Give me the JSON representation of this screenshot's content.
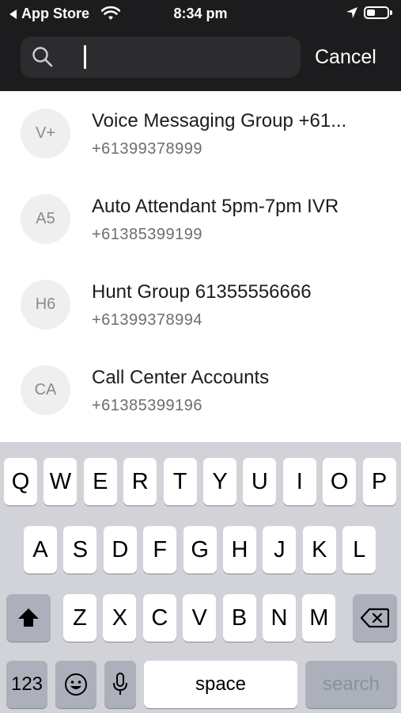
{
  "status_bar": {
    "back_label": "App Store",
    "time": "8:34 pm",
    "battery_level": 0.4
  },
  "search": {
    "value": "",
    "placeholder": "",
    "cancel_label": "Cancel"
  },
  "results": [
    {
      "initials": "V+",
      "name": "Voice Messaging Group +61...",
      "phone": "+61399378999"
    },
    {
      "initials": "A5",
      "name": "Auto Attendant 5pm-7pm IVR",
      "phone": "+61385399199"
    },
    {
      "initials": "H6",
      "name": "Hunt Group 61355556666",
      "phone": "+61399378994"
    },
    {
      "initials": "CA",
      "name": "Call Center Accounts",
      "phone": "+61385399196"
    }
  ],
  "keyboard": {
    "row1": [
      "Q",
      "W",
      "E",
      "R",
      "T",
      "Y",
      "U",
      "I",
      "O",
      "P"
    ],
    "row2": [
      "A",
      "S",
      "D",
      "F",
      "G",
      "H",
      "J",
      "K",
      "L"
    ],
    "row3": [
      "Z",
      "X",
      "C",
      "V",
      "B",
      "N",
      "M"
    ],
    "numbers_label": "123",
    "space_label": "space",
    "search_label": "search",
    "icons": {
      "shift": "shift-icon",
      "delete": "delete-icon",
      "emoji": "emoji-icon",
      "mic": "microphone-icon"
    }
  }
}
